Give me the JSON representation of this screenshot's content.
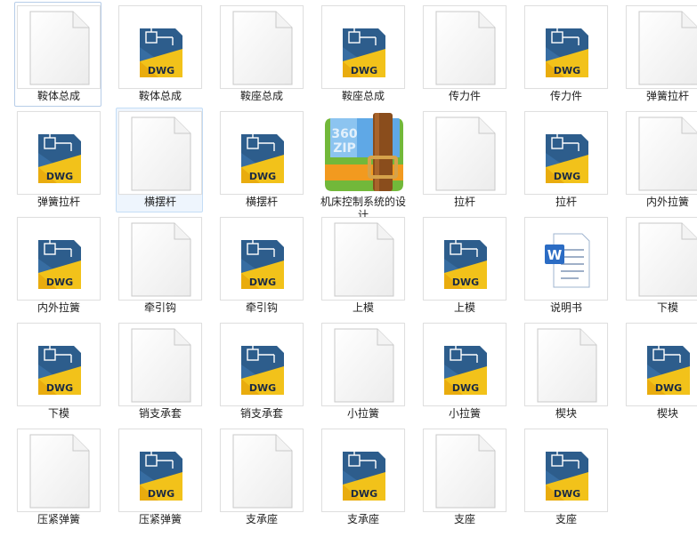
{
  "files": [
    {
      "name": "鞍体总成",
      "type": "blank"
    },
    {
      "name": "鞍体总成",
      "type": "dwg"
    },
    {
      "name": "鞍座总成",
      "type": "blank"
    },
    {
      "name": "鞍座总成",
      "type": "dwg"
    },
    {
      "name": "传力件",
      "type": "blank"
    },
    {
      "name": "传力件",
      "type": "dwg"
    },
    {
      "name": "弹簧拉杆",
      "type": "blank"
    },
    {
      "name": "弹簧拉杆",
      "type": "dwg"
    },
    {
      "name": "横摆杆",
      "type": "blank",
      "selected": true
    },
    {
      "name": "横摆杆",
      "type": "dwg"
    },
    {
      "name": "机床控制系统的设计",
      "type": "zip"
    },
    {
      "name": "拉杆",
      "type": "blank"
    },
    {
      "name": "拉杆",
      "type": "dwg"
    },
    {
      "name": "内外拉簧",
      "type": "blank"
    },
    {
      "name": "内外拉簧",
      "type": "dwg"
    },
    {
      "name": "牵引钩",
      "type": "blank"
    },
    {
      "name": "牵引钩",
      "type": "dwg"
    },
    {
      "name": "上模",
      "type": "blank"
    },
    {
      "name": "上模",
      "type": "dwg"
    },
    {
      "name": "说明书",
      "type": "word"
    },
    {
      "name": "下模",
      "type": "blank"
    },
    {
      "name": "下模",
      "type": "dwg"
    },
    {
      "name": "销支承套",
      "type": "blank"
    },
    {
      "name": "销支承套",
      "type": "dwg"
    },
    {
      "name": "小拉簧",
      "type": "blank"
    },
    {
      "name": "小拉簧",
      "type": "dwg"
    },
    {
      "name": "楔块",
      "type": "blank"
    },
    {
      "name": "楔块",
      "type": "dwg"
    },
    {
      "name": "压紧弹簧",
      "type": "blank"
    },
    {
      "name": "压紧弹簧",
      "type": "dwg"
    },
    {
      "name": "支承座",
      "type": "blank"
    },
    {
      "name": "支承座",
      "type": "dwg"
    },
    {
      "name": "支座",
      "type": "blank"
    },
    {
      "name": "支座",
      "type": "dwg"
    }
  ],
  "icons": {
    "dwg_text": "DWG",
    "zip_text_1": "360",
    "zip_text_2": "ZIP"
  },
  "colors": {
    "dwg_blue": "#2d5d8c",
    "dwg_yellow": "#f2c21a",
    "zip_green": "#72b83a",
    "zip_orange": "#f29a1f",
    "word_blue": "#2b6cc4",
    "selected_bg": "#eef5fd"
  }
}
